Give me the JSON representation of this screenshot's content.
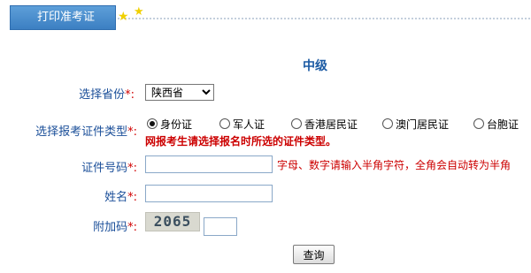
{
  "header": {
    "tab_label": "打印准考证"
  },
  "level_title": "中级",
  "form": {
    "province": {
      "label": "选择省份",
      "required_mark": "*:",
      "selected": "陕西省"
    },
    "id_type": {
      "label": "选择报考证件类型",
      "required_mark": "*:",
      "options": [
        "身份证",
        "军人证",
        "香港居民证",
        "澳门居民证",
        "台胞证"
      ],
      "selected": "身份证",
      "warning": "网报考生请选择报名时所选的证件类型。"
    },
    "id_number": {
      "label": "证件号码",
      "required_mark": "*:",
      "value": "",
      "hint": "字母、数字请输入半角字符，全角会自动转为半角"
    },
    "name": {
      "label": "姓名",
      "required_mark": "*:",
      "value": ""
    },
    "captcha": {
      "label": "附加码",
      "required_mark": "*:",
      "code": "2065",
      "value": ""
    },
    "submit_label": "查询"
  },
  "icons": {
    "star": "star-icon"
  },
  "colors": {
    "tab_bg": "#4a8fd0",
    "label": "#1b4f99",
    "required": "#d00000",
    "warning": "#cc0000",
    "title": "#1b5aa3"
  }
}
